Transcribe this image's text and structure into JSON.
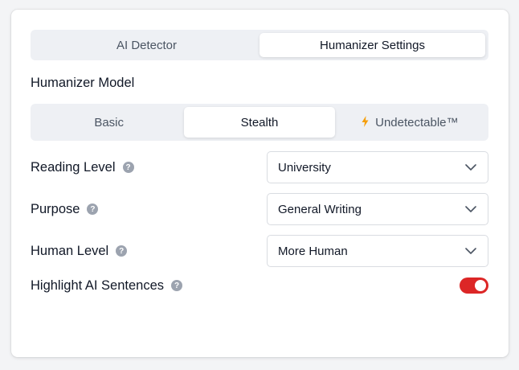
{
  "tabs": [
    {
      "label": "AI Detector",
      "active": false
    },
    {
      "label": "Humanizer Settings",
      "active": true
    }
  ],
  "model_section": {
    "title": "Humanizer Model",
    "options": [
      {
        "label": "Basic",
        "active": false
      },
      {
        "label": "Stealth",
        "active": true
      },
      {
        "label": "Undetectable™",
        "active": false,
        "icon": "bolt-icon"
      }
    ]
  },
  "settings": {
    "reading_level": {
      "label": "Reading Level",
      "help": "?",
      "value": "University"
    },
    "purpose": {
      "label": "Purpose",
      "help": "?",
      "value": "General Writing"
    },
    "human_level": {
      "label": "Human Level",
      "help": "?",
      "value": "More Human"
    },
    "highlight": {
      "label": "Highlight AI Sentences",
      "help": "?",
      "enabled": true
    }
  },
  "colors": {
    "toggle_on": "#dc2626",
    "bolt": "#f59e0b",
    "segment_bg": "#eef0f4"
  }
}
